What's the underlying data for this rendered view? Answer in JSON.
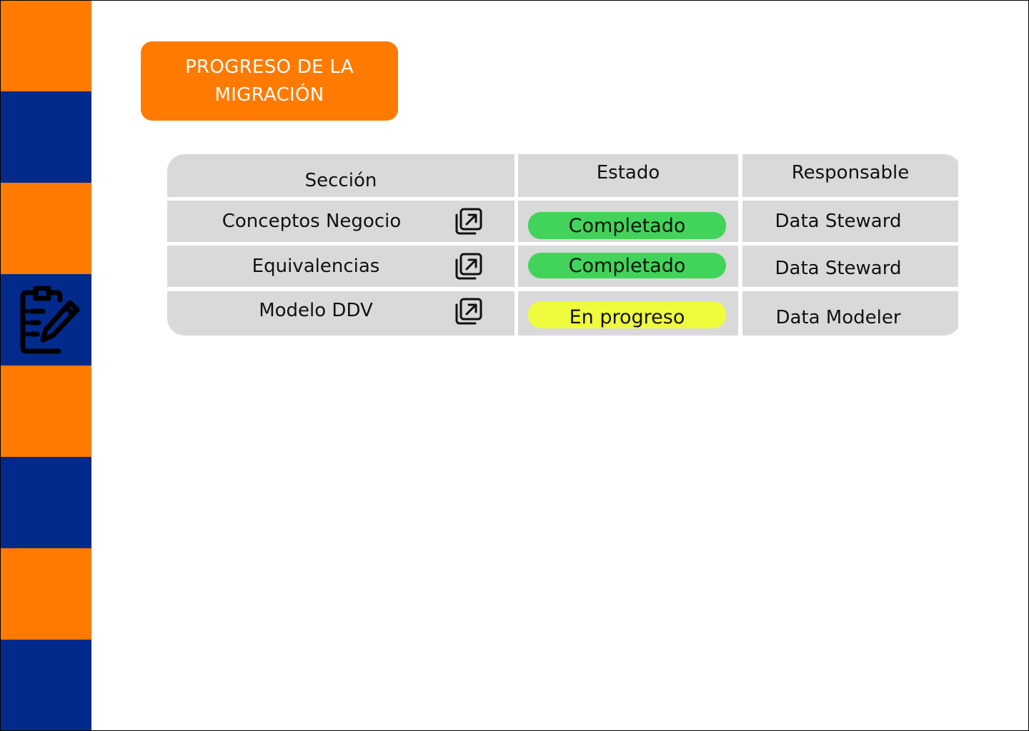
{
  "colors": {
    "accent_orange": "#ff7a00",
    "accent_blue": "#012a8c",
    "cell_gray": "#d9d9d9",
    "status_done": "#42d45a",
    "status_progress": "#eefc3d"
  },
  "sidebar": {
    "blocks": [
      "orange",
      "blue",
      "orange",
      "blue-icon",
      "orange",
      "blue",
      "orange",
      "blue"
    ],
    "icon": "clipboard-edit-icon"
  },
  "title_card": {
    "text": "PROGRESO DE LA MIGRACIÓN"
  },
  "table": {
    "headers": {
      "section": "Sección",
      "status": "Estado",
      "owner": "Responsable"
    },
    "rows": [
      {
        "section": "Conceptos Negocio",
        "link_icon": "open-external-icon",
        "status": "Completado",
        "status_color": "#42d45a",
        "owner": "Data Steward"
      },
      {
        "section": "Equivalencias",
        "link_icon": "open-external-icon",
        "status": "Completado",
        "status_color": "#42d45a",
        "owner": "Data Steward"
      },
      {
        "section": "Modelo DDV",
        "link_icon": "open-external-icon",
        "status": "En progreso",
        "status_color": "#eefc3d",
        "owner": "Data Modeler"
      }
    ]
  }
}
